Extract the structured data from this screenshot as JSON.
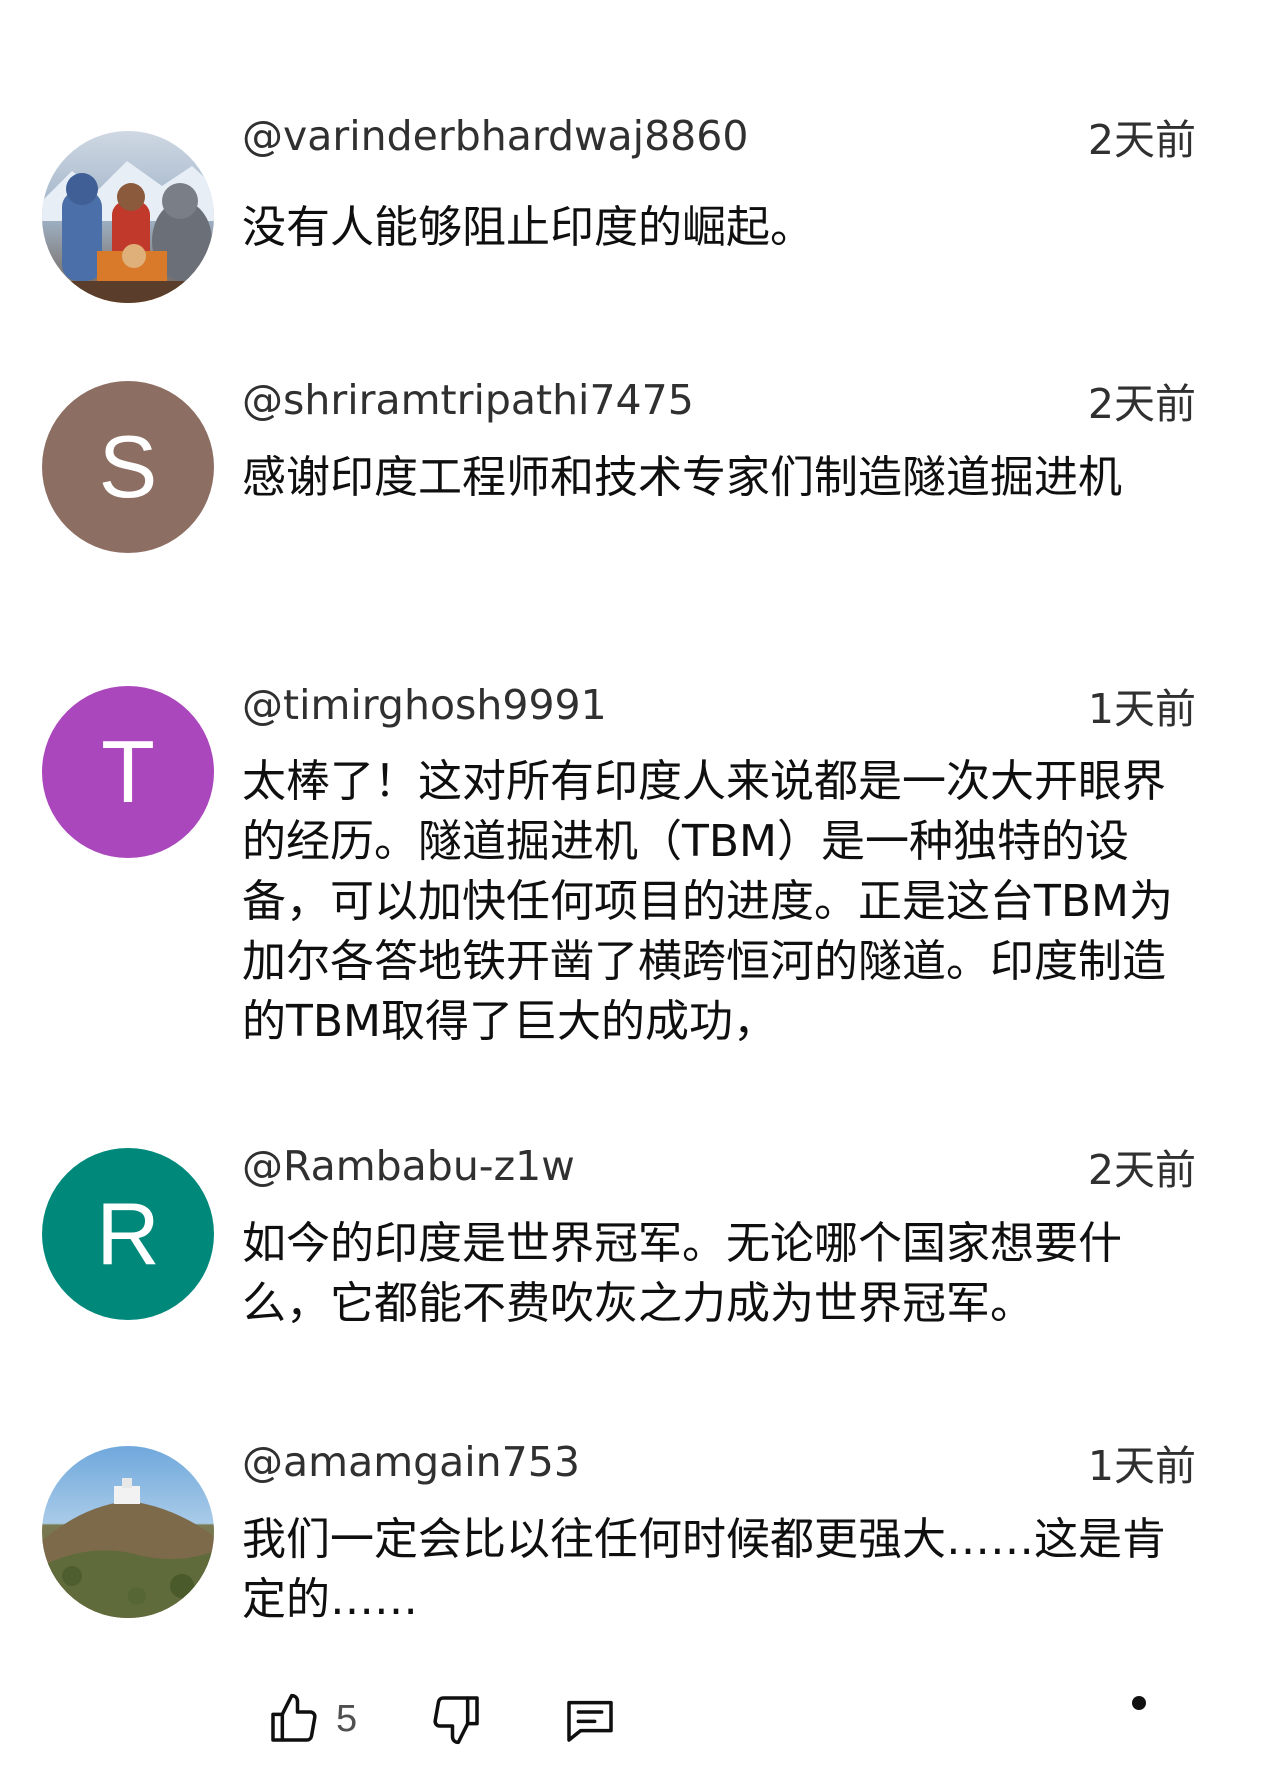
{
  "comments": [
    {
      "author": "@varinderbhardwaj8860",
      "time": "2天前",
      "text": "没有人能够阻止印度的崛起。",
      "avatar": {
        "kind": "image",
        "icon": "deity-painting-avatar"
      }
    },
    {
      "author": "@shriramtripathi7475",
      "time": "2天前",
      "text": "感谢印度工程师和技术专家们制造隧道掘进机",
      "avatar": {
        "kind": "letter",
        "letter": "S",
        "color": "#8d6e63"
      }
    },
    {
      "author": "@timirghosh9991",
      "time": "1天前",
      "text": "太棒了！这对所有印度人来说都是一次大开眼界的经历。隧道掘进机（TBM）是一种独特的设备，可以加快任何项目的进度。正是这台TBM为加尔各答地铁开凿了横跨恒河的隧道。印度制造的TBM取得了巨大的成功，",
      "avatar": {
        "kind": "letter",
        "letter": "T",
        "color": "#ab47bc"
      }
    },
    {
      "author": "@Rambabu-z1w",
      "time": "2天前",
      "text": "如今的印度是世界冠军。无论哪个国家想要什么，它都能不费吹灰之力成为世界冠军。",
      "avatar": {
        "kind": "letter",
        "letter": "R",
        "color": "#00897b"
      }
    },
    {
      "author": "@amamgain753",
      "time": "1天前",
      "text": "我们一定会比以往任何时候都更强大……这是肯定的……",
      "avatar": {
        "kind": "image",
        "icon": "hilltop-landscape-avatar"
      }
    }
  ],
  "actions": {
    "like_count": "5",
    "like_icon": "thumb-up-icon",
    "dislike_icon": "thumb-down-icon",
    "reply_icon": "reply-comment-icon"
  }
}
